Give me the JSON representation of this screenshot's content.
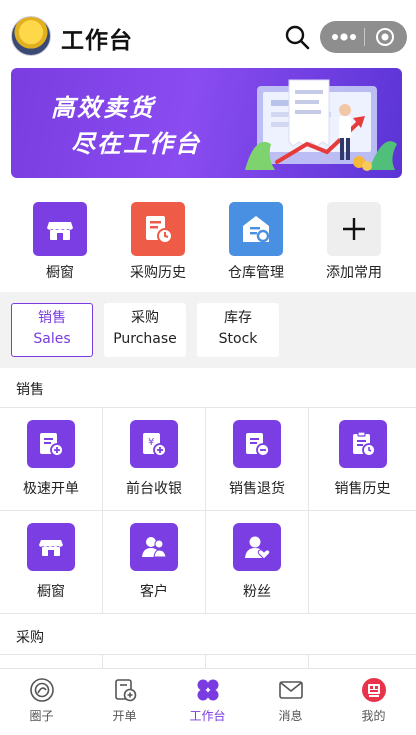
{
  "header": {
    "title": "工作台",
    "avatar_icon": "pikachu-avatar",
    "search_icon": "search-icon",
    "capsule_more_icon": "more-dots-icon",
    "capsule_close_icon": "target-icon"
  },
  "banner": {
    "line1": "高效卖货",
    "line2": "尽在工作台"
  },
  "quick_apps": [
    {
      "label": "橱窗",
      "icon": "storefront-icon",
      "color": "#7b3ee3"
    },
    {
      "label": "采购历史",
      "icon": "purchase-history-icon",
      "color": "#ee5b47"
    },
    {
      "label": "仓库管理",
      "icon": "warehouse-icon",
      "color": "#4a90e2"
    },
    {
      "label": "添加常用",
      "icon": "plus-icon",
      "color": "#eeeeee"
    }
  ],
  "tabs": [
    {
      "cn": "销售",
      "en": "Sales"
    },
    {
      "cn": "采购",
      "en": "Purchase"
    },
    {
      "cn": "库存",
      "en": "Stock"
    }
  ],
  "sales": {
    "title": "销售",
    "items": [
      {
        "label": "极速开单",
        "icon": "quick-order-icon"
      },
      {
        "label": "前台收银",
        "icon": "cashier-icon"
      },
      {
        "label": "销售退货",
        "icon": "sales-return-icon"
      },
      {
        "label": "销售历史",
        "icon": "sales-history-icon"
      },
      {
        "label": "橱窗",
        "icon": "storefront-icon"
      },
      {
        "label": "客户",
        "icon": "customers-icon"
      },
      {
        "label": "粉丝",
        "icon": "fans-icon"
      }
    ]
  },
  "purchase": {
    "title": "采购"
  },
  "bottom_nav": [
    {
      "label": "圈子",
      "icon": "circle-icon"
    },
    {
      "label": "开单",
      "icon": "order-icon"
    },
    {
      "label": "工作台",
      "icon": "workbench-icon"
    },
    {
      "label": "消息",
      "icon": "message-icon"
    },
    {
      "label": "我的",
      "icon": "profile-icon"
    }
  ],
  "colors": {
    "accent": "#7a3ce0",
    "banner": "#7a3de0"
  }
}
